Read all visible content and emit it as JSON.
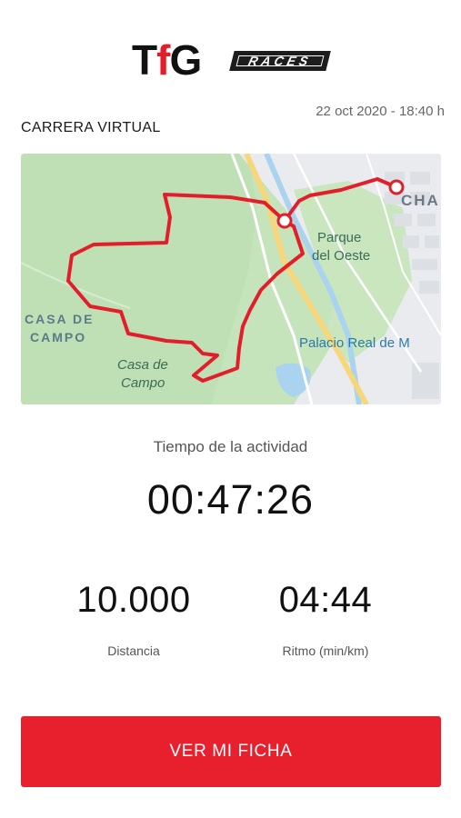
{
  "brand": {
    "logo_prefix": "T",
    "logo_accent": "f",
    "logo_suffix": "G",
    "logo_tag": "RACES",
    "accent_color": "#e21e2b"
  },
  "header": {
    "date": "22 oct 2020 - 18:40 h",
    "title": "CARRERA VIRTUAL"
  },
  "map": {
    "labels": {
      "casa_de_campo_area_line1": "CASA DE",
      "casa_de_campo_area_line2": "CAMPO",
      "casa_de_campo_line1": "Casa de",
      "casa_de_campo_line2": "Campo",
      "parque_line1": "Parque",
      "parque_line2": "del Oeste",
      "palacio": "Palacio Real de M",
      "cha": "CHA"
    },
    "route_color": "#e21e2b"
  },
  "activity": {
    "label": "Tiempo de la actividad",
    "time": "00:47:26"
  },
  "stats": {
    "distance_value": "10.000",
    "distance_label": "Distancia",
    "pace_value": "04:44",
    "pace_label": "Ritmo (min/km)"
  },
  "cta": {
    "label": "VER MI FICHA"
  }
}
